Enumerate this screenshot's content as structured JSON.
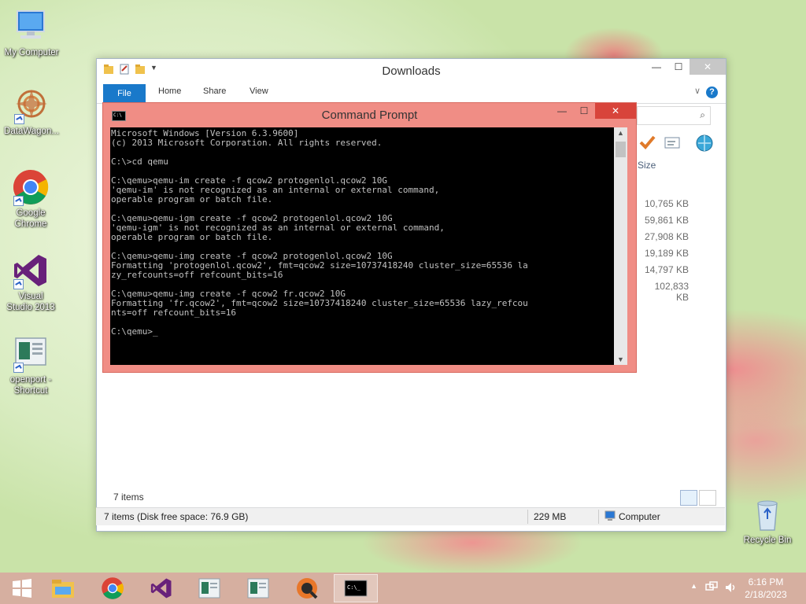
{
  "desktop": {
    "icons": [
      {
        "label": "My Computer",
        "icon": "computer-icon"
      },
      {
        "label": "DataWagon...",
        "icon": "datawagon-icon"
      },
      {
        "label": "Google Chrome",
        "icon": "chrome-icon"
      },
      {
        "label": "Visual Studio 2013",
        "icon": "visual-studio-icon"
      },
      {
        "label": "openport - Shortcut",
        "icon": "openport-icon"
      },
      {
        "label": "Recycle Bin",
        "icon": "recycle-bin-icon"
      }
    ]
  },
  "explorer": {
    "title": "Downloads",
    "tabs": {
      "file": "File",
      "home": "Home",
      "share": "Share",
      "view": "View"
    },
    "help": "?",
    "column_size": "Size",
    "sizes": [
      "10,765 KB",
      "59,861 KB",
      "27,908 KB",
      "19,189 KB",
      "14,797 KB",
      "102,833 KB"
    ],
    "item_count": "7 items",
    "status": {
      "left": "7 items (Disk free space: 76.9 GB)",
      "size": "229 MB",
      "location": "Computer"
    }
  },
  "cmd": {
    "title": "Command Prompt",
    "output": "Microsoft Windows [Version 6.3.9600]\n(c) 2013 Microsoft Corporation. All rights reserved.\n\nC:\\>cd qemu\n\nC:\\qemu>qemu-im create -f qcow2 protogenlol.qcow2 10G\n'qemu-im' is not recognized as an internal or external command,\noperable program or batch file.\n\nC:\\qemu>qemu-igm create -f qcow2 protogenlol.qcow2 10G\n'qemu-igm' is not recognized as an internal or external command,\noperable program or batch file.\n\nC:\\qemu>qemu-img create -f qcow2 protogenlol.qcow2 10G\nFormatting 'protogenlol.qcow2', fmt=qcow2 size=10737418240 cluster_size=65536 la\nzy_refcounts=off refcount_bits=16\n\nC:\\qemu>qemu-img create -f qcow2 fr.qcow2 10G\nFormatting 'fr.qcow2', fmt=qcow2 size=10737418240 cluster_size=65536 lazy_refcou\nnts=off refcount_bits=16\n\nC:\\qemu>_"
  },
  "taskbar": {
    "items": [
      "start-icon",
      "file-explorer-icon",
      "chrome-icon",
      "visual-studio-icon",
      "openport-icon",
      "openport-icon",
      "qemu-icon",
      "command-prompt-icon"
    ],
    "time": "6:16 PM",
    "date": "2/18/2023"
  }
}
